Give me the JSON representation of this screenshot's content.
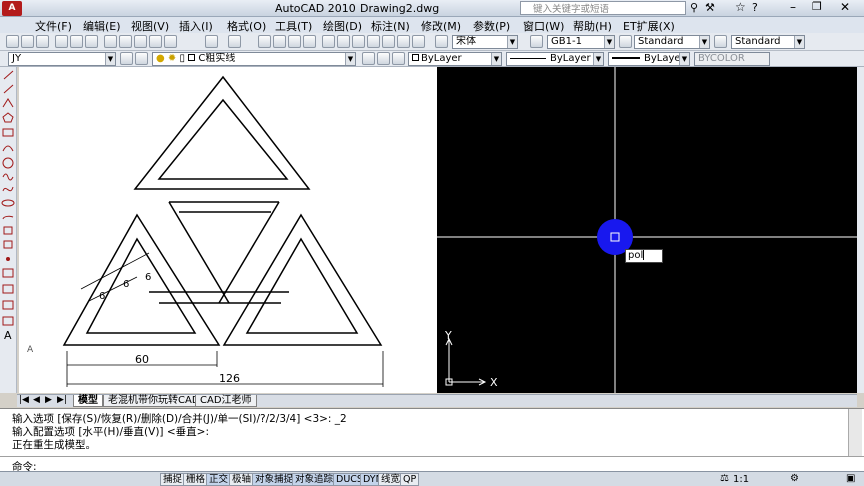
{
  "window": {
    "app_name": "AutoCAD 2010",
    "file_name": "Drawing2.dwg",
    "search_placeholder": "键入关键字或短语"
  },
  "menu": [
    "文件(F)",
    "编辑(E)",
    "视图(V)",
    "插入(I)",
    "格式(O)",
    "工具(T)",
    "绘图(D)",
    "标注(N)",
    "修改(M)",
    "参数(P)",
    "窗口(W)",
    "帮助(H)",
    "ET扩展(X)"
  ],
  "toolbar": {
    "font_combo": "宋体",
    "dimstyle_combo": "GB1-1",
    "textstyle_combo": "Standard",
    "tablestyle_combo": "Standard",
    "layer_state_combo": "JY",
    "layer_combo": "C粗实线",
    "color_combo": "ByLayer",
    "linetype_combo": "ByLayer",
    "lineweight_combo": "ByLayer",
    "plotstyle_combo": "BYCOLOR"
  },
  "drawing": {
    "dim_60": "60",
    "dim_126": "126",
    "dim_6a": "6",
    "dim_6b": "6",
    "dim_6c": "6"
  },
  "viewport": {
    "dynamic_input": "pol",
    "axis_x": "X",
    "axis_y": "Y"
  },
  "tabs": [
    "模型",
    "老混机带你玩转CAD",
    "CAD江老师"
  ],
  "command": {
    "line1": "输入选项 [保存(S)/恢复(R)/删除(D)/合并(J)/单一(SI)/?/2/3/4] <3>: _2",
    "line2": "输入配置选项 [水平(H)/垂直(V)] <垂直>:",
    "line3": "正在重生成模型。",
    "prompt": "命令:"
  },
  "status": {
    "buttons": [
      "捕捉",
      "栅格",
      "正交",
      "极轴",
      "对象捕捉",
      "对象追踪",
      "DUCS",
      "DYN",
      "线宽",
      "QP"
    ],
    "scale": "1:1"
  }
}
